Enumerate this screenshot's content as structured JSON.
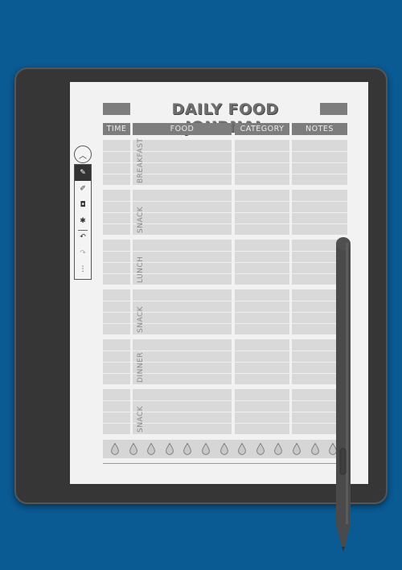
{
  "journal": {
    "title": "DAILY FOOD JOURNAL",
    "columns": [
      "TIME",
      "FOOD",
      "CATEGORY",
      "NOTES"
    ],
    "meals": [
      {
        "label": "BREAKFAST",
        "rows": 4
      },
      {
        "label": "SNACK",
        "rows": 4
      },
      {
        "label": "LUNCH",
        "rows": 4
      },
      {
        "label": "SNACK",
        "rows": 4
      },
      {
        "label": "DINNER",
        "rows": 4
      },
      {
        "label": "SNACK",
        "rows": 4
      }
    ],
    "water_drops": 13
  },
  "toolbar": {
    "collapse_icon": "chevron-up-icon",
    "tools": [
      {
        "name": "pen-tool",
        "icon": "pen-icon",
        "glyph": "✎",
        "active": true
      },
      {
        "name": "highlighter-tool",
        "icon": "highlighter-icon",
        "glyph": "✐",
        "active": false
      },
      {
        "name": "eraser-tool",
        "icon": "eraser-icon",
        "glyph": "◘",
        "active": false
      },
      {
        "name": "lasso-tool",
        "icon": "lasso-icon",
        "glyph": "✱",
        "active": false
      },
      {
        "name": "undo-button",
        "icon": "undo-icon",
        "glyph": "↶",
        "active": false
      },
      {
        "name": "redo-button",
        "icon": "redo-icon",
        "glyph": "↷",
        "active": false
      },
      {
        "name": "more-button",
        "icon": "more-icon",
        "glyph": "⋮",
        "active": false
      }
    ]
  },
  "colors": {
    "background": "#0a5a94",
    "device": "#363636",
    "header_fill": "#7d7d7d",
    "cell_fill": "#d9d9d9"
  }
}
